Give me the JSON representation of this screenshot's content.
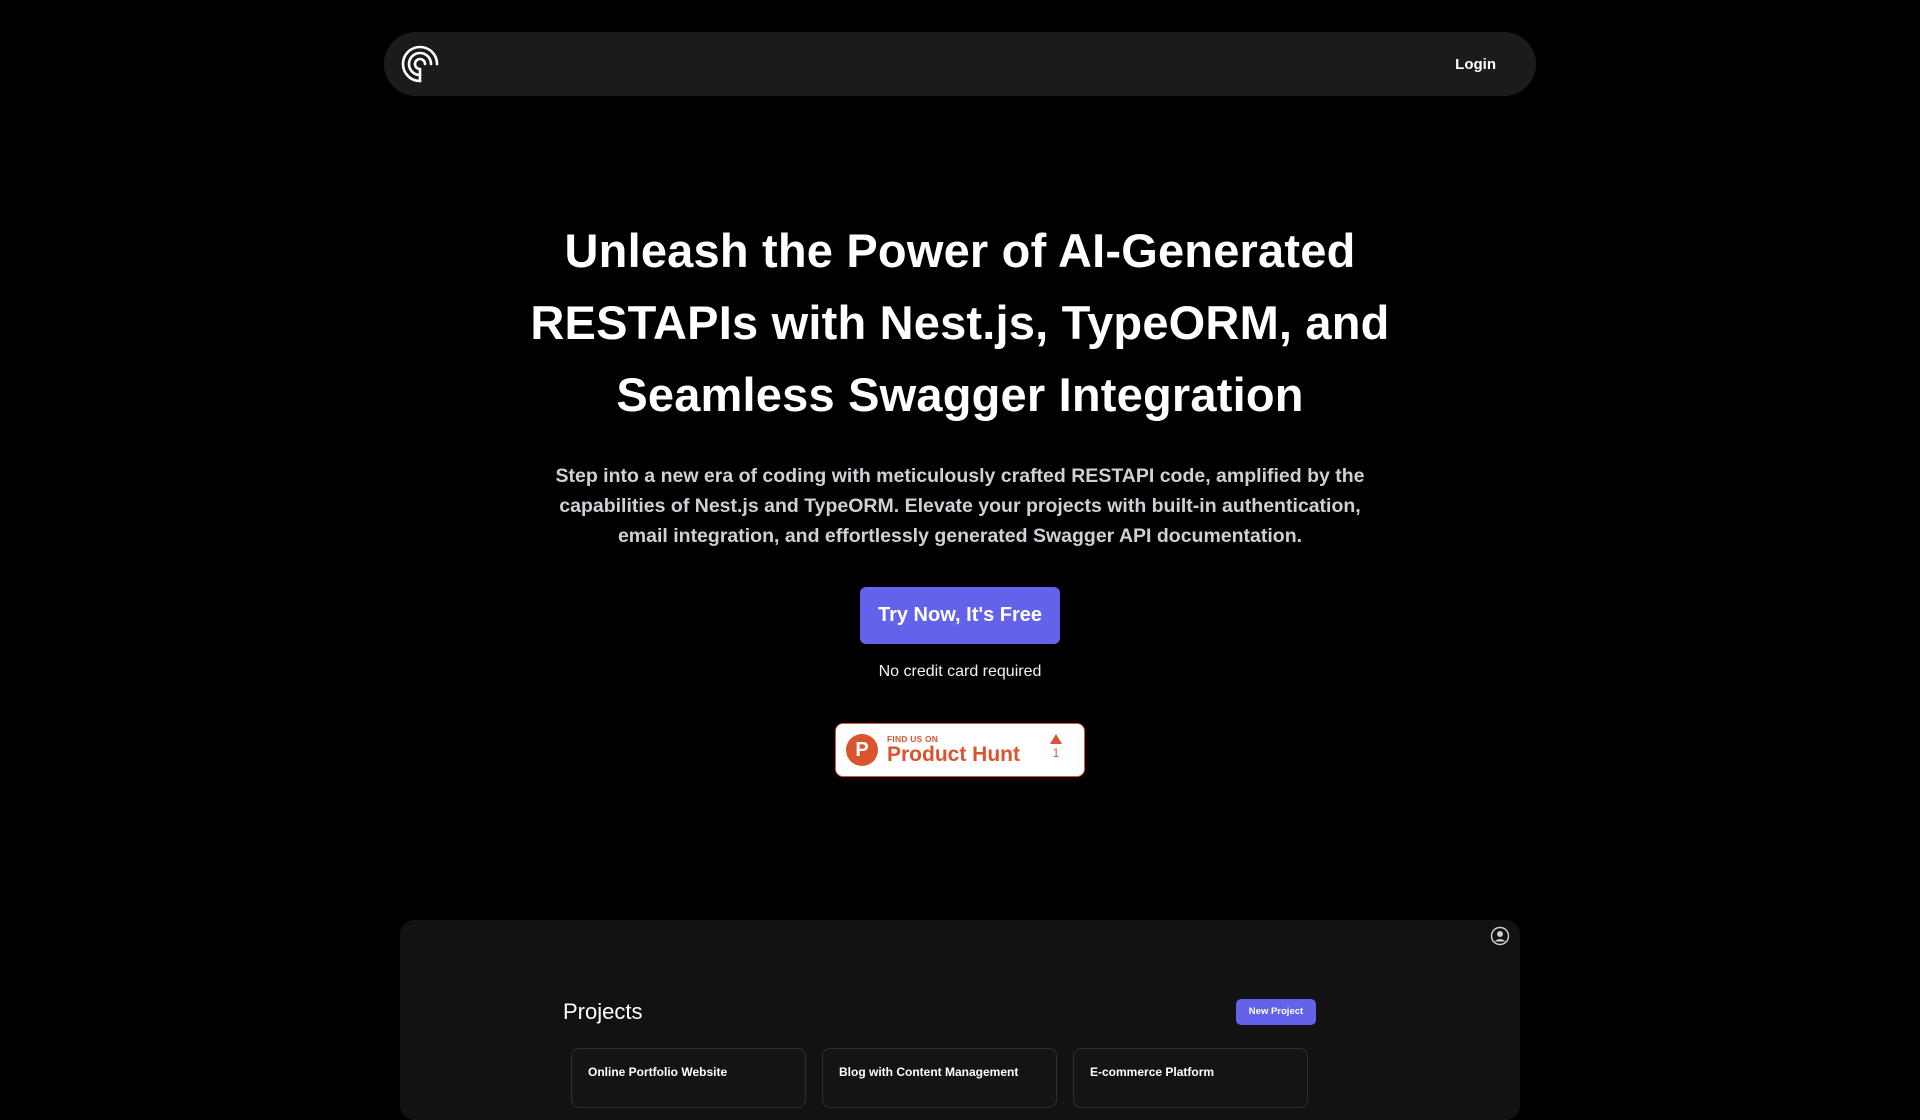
{
  "nav": {
    "login_label": "Login"
  },
  "hero": {
    "title": "Unleash the Power of AI-Generated RESTAPIs with Nest.js, TypeORM, and Seamless Swagger Integration",
    "subtitle": "Step into a new era of coding with meticulously crafted RESTAPI code, amplified by the capabilities of Nest.js and TypeORM. Elevate your projects with built-in authentication, email integration, and effortlessly generated Swagger API documentation.",
    "cta_label": "Try Now, It's Free",
    "note": "No credit card required"
  },
  "product_hunt": {
    "letter": "P",
    "small_text": "FIND US ON",
    "big_text": "Product Hunt",
    "votes": "1"
  },
  "preview": {
    "title": "Projects",
    "new_project_label": "New Project",
    "projects": [
      {
        "name": "Online Portfolio Website"
      },
      {
        "name": "Blog with Content Management"
      },
      {
        "name": "E-commerce Platform"
      }
    ]
  },
  "colors": {
    "background": "#000000",
    "navbar": "#1b1b1b",
    "accent": "#6362ea",
    "product_hunt": "#da552f"
  }
}
